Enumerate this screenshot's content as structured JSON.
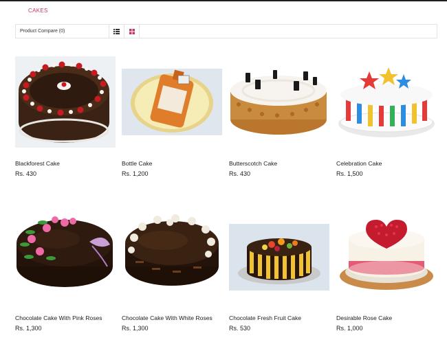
{
  "breadcrumb": "CAKES",
  "toolbar": {
    "compare_label": "Product Compare (0)",
    "list_icon": "list-view-icon",
    "grid_icon": "grid-view-icon",
    "accent": "#c0396a"
  },
  "products": [
    {
      "name": "Blackforest Cake",
      "price": "Rs. 430"
    },
    {
      "name": "Bottle Cake",
      "price": "Rs. 1,200"
    },
    {
      "name": "Butterscotch Cake",
      "price": "Rs. 430"
    },
    {
      "name": "Celebration Cake",
      "price": "Rs. 1,500"
    },
    {
      "name": "Chocolate Cake With Pink Roses",
      "price": "Rs. 1,300"
    },
    {
      "name": "Chocolate Cake With White Roses",
      "price": "Rs. 1,300"
    },
    {
      "name": "Chocolate Fresh Fruit Cake",
      "price": "Rs. 530"
    },
    {
      "name": "Desirable Rose Cake",
      "price": "Rs. 1,000"
    }
  ]
}
